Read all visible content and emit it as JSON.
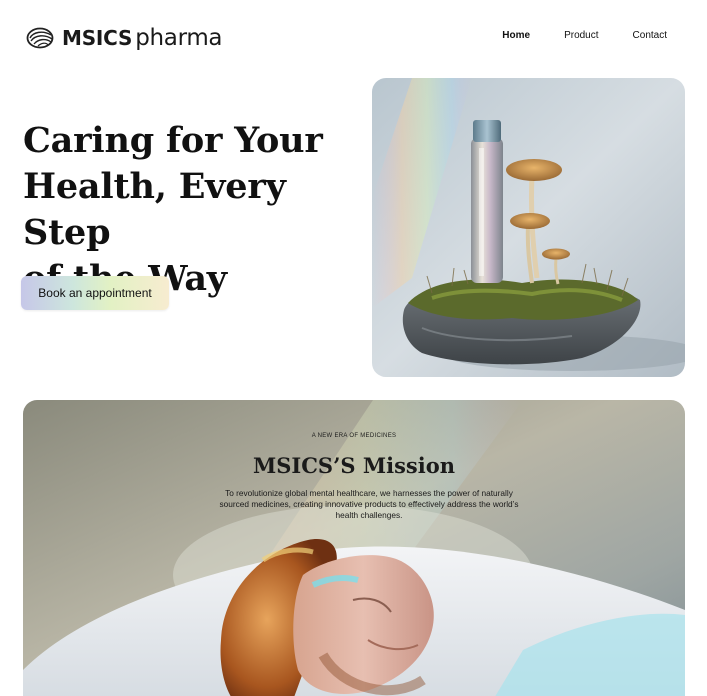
{
  "header": {
    "brand": "MSICS",
    "brand_suffix": "pharma",
    "nav": [
      {
        "label": "Home"
      },
      {
        "label": "Product"
      },
      {
        "label": "Contact"
      }
    ]
  },
  "hero": {
    "title_line1": "Caring for Your",
    "title_line2": "Health, Every Step",
    "title_line3": "of the Way",
    "cta_label": "Book an appointment"
  },
  "mission": {
    "eyebrow": "A NEW ERA OF MEDICINES",
    "title": "MSICS’S Mission",
    "body": "To revolutionize global mental healthcare, we harnesses the power of naturally sourced medicines, creating innovative products to effectively address the world’s health challenges."
  }
}
